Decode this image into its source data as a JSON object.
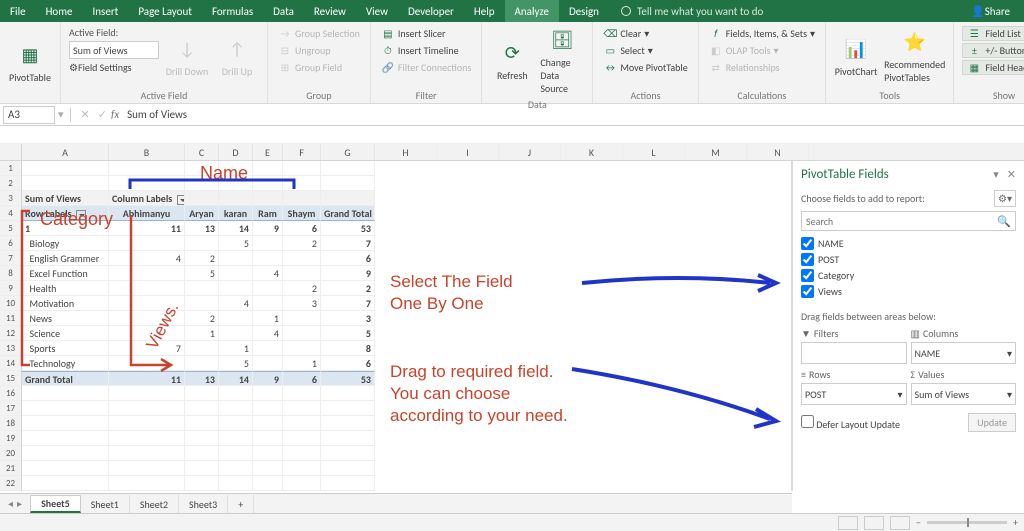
{
  "app": {
    "tabs": [
      "File",
      "Home",
      "Insert",
      "Page Layout",
      "Formulas",
      "Data",
      "Review",
      "View",
      "Developer",
      "Help",
      "Analyze",
      "Design"
    ],
    "active_tab": "Analyze",
    "tellme": "Tell me what you want to do",
    "share": "Share"
  },
  "ribbon": {
    "pivottable": "PivotTable",
    "af_label": "Active Field:",
    "af_value": "Sum of Views",
    "af_settings": "Field Settings",
    "drilldown": "Drill Down",
    "drillup": "Drill Up",
    "group1": "Active Field",
    "gs": "Group Selection",
    "ug": "Ungroup",
    "gf": "Group Field",
    "group2": "Group",
    "islicer": "Insert Slicer",
    "itime": "Insert Timeline",
    "fconn": "Filter Connections",
    "group3": "Filter",
    "refresh": "Refresh",
    "cds": "Change Data Source",
    "group4": "Data",
    "clear": "Clear",
    "select": "Select",
    "movept": "Move PivotTable",
    "group5": "Actions",
    "fis": "Fields, Items, & Sets",
    "olap": "OLAP Tools",
    "rel": "Relationships",
    "group6": "Calculations",
    "pchart": "PivotChart",
    "rpt": "Recommended PivotTables",
    "group7": "Tools",
    "flist": "Field List",
    "pmbtn": "+/- Buttons",
    "fhead": "Field Headers",
    "group8": "Show"
  },
  "formula": {
    "cell": "A3",
    "value": "Sum of Views"
  },
  "columns": [
    "A",
    "B",
    "C",
    "D",
    "E",
    "F",
    "G",
    "H",
    "I",
    "J",
    "K",
    "L",
    "M",
    "N"
  ],
  "pivot": {
    "corner": "Sum of Views",
    "collbl": "Column Labels",
    "rowlbl": "Row Labels",
    "names": [
      "Abhimanyu",
      "Aryan",
      "karan",
      "Ram",
      "Shaym",
      "Grand Total"
    ],
    "rows": [
      {
        "l": "1",
        "v": [
          "11",
          "13",
          "14",
          "9",
          "6",
          "53"
        ],
        "bold": true
      },
      {
        "l": "Biology",
        "v": [
          "",
          "",
          "5",
          "",
          "2",
          "7"
        ]
      },
      {
        "l": "English Grammer",
        "v": [
          "4",
          "2",
          "",
          "",
          "",
          "6"
        ]
      },
      {
        "l": "Excel Function",
        "v": [
          "",
          "5",
          "",
          "4",
          "",
          "9"
        ]
      },
      {
        "l": "Health",
        "v": [
          "",
          "",
          "",
          "",
          "2",
          "2"
        ]
      },
      {
        "l": "Motivation",
        "v": [
          "",
          "",
          "4",
          "",
          "3",
          "7"
        ]
      },
      {
        "l": "News",
        "v": [
          "",
          "2",
          "",
          "1",
          "",
          "3"
        ]
      },
      {
        "l": "Science",
        "v": [
          "",
          "1",
          "",
          "4",
          "",
          "5"
        ]
      },
      {
        "l": "Sports",
        "v": [
          "7",
          "",
          "1",
          "",
          "",
          "8"
        ]
      },
      {
        "l": "Technology",
        "v": [
          "",
          "",
          "5",
          "",
          "1",
          "6"
        ]
      }
    ],
    "gt": {
      "l": "Grand Total",
      "v": [
        "11",
        "13",
        "14",
        "9",
        "6",
        "53"
      ]
    }
  },
  "annot": {
    "name": "Name",
    "category": "Category",
    "views": "Views.",
    "sel": "Select The Field\nOne By One",
    "drag": "Drag to required field. You can choose according to your need."
  },
  "pane": {
    "title": "PivotTable Fields",
    "hint": "Choose fields to add to report:",
    "search_ph": "Search",
    "fields": [
      "NAME",
      "POST",
      "Category",
      "Views"
    ],
    "areahint": "Drag fields between areas below:",
    "filters": "Filters",
    "columns": "Columns",
    "rows": "Rows",
    "values": "Values",
    "col_val": "NAME",
    "row_val": "POST",
    "val_val": "Sum of Views",
    "defer": "Defer Layout Update",
    "update": "Update"
  },
  "sheets": {
    "tabs": [
      "Sheet5",
      "Sheet1",
      "Sheet2",
      "Sheet3"
    ],
    "active": "Sheet5",
    "add": "+"
  },
  "chart_data": {
    "type": "table",
    "title": "Sum of Views",
    "columns": [
      "Abhimanyu",
      "Aryan",
      "karan",
      "Ram",
      "Shaym"
    ],
    "rows": [
      "Biology",
      "English Grammer",
      "Excel Function",
      "Health",
      "Motivation",
      "News",
      "Science",
      "Sports",
      "Technology"
    ],
    "values": [
      [
        null,
        null,
        5,
        null,
        2
      ],
      [
        4,
        2,
        null,
        null,
        null
      ],
      [
        null,
        5,
        null,
        4,
        null
      ],
      [
        null,
        null,
        null,
        null,
        2
      ],
      [
        null,
        null,
        4,
        null,
        3
      ],
      [
        null,
        2,
        null,
        1,
        null
      ],
      [
        null,
        1,
        null,
        4,
        null
      ],
      [
        7,
        null,
        1,
        null,
        null
      ],
      [
        null,
        null,
        5,
        null,
        1
      ]
    ],
    "row_totals": [
      7,
      6,
      9,
      2,
      7,
      3,
      5,
      8,
      6
    ],
    "column_totals": [
      11,
      13,
      14,
      9,
      6
    ],
    "grand_total": 53
  }
}
